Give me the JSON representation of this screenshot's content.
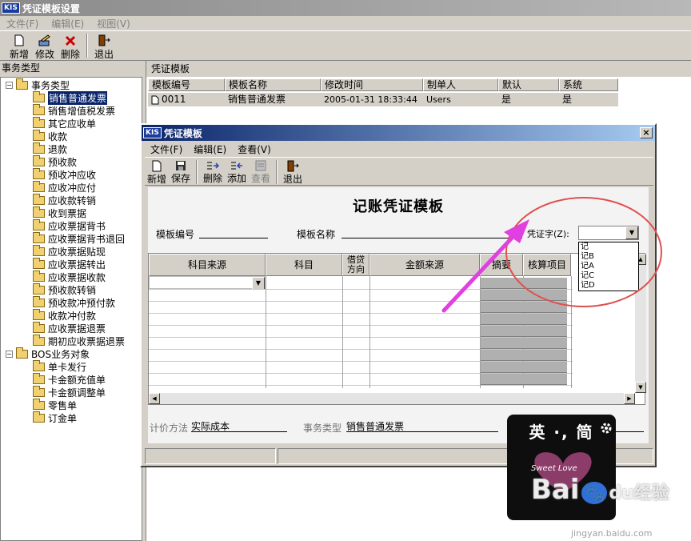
{
  "app": {
    "logo": "KIS",
    "title": "凭证模板设置"
  },
  "menu": [
    "文件(F)",
    "编辑(E)",
    "视图(V)"
  ],
  "toolbar": {
    "new": "新增",
    "edit": "修改",
    "delete": "删除",
    "exit": "退出"
  },
  "left_panel": {
    "header": "事务类型",
    "root1": "事务类型",
    "items1": [
      "销售普通发票",
      "销售增值税发票",
      "其它应收单",
      "收款",
      "退款",
      "预收款",
      "预收冲应收",
      "应收冲应付",
      "应收款转销",
      "收到票据",
      "应收票据背书",
      "应收票据背书退回",
      "应收票据贴现",
      "应收票据转出",
      "应收票据收款",
      "预收款转销",
      "预收款冲预付款",
      "收款冲付款",
      "应收票据退票",
      "期初应收票据退票"
    ],
    "root2": "BOS业务对象",
    "items2": [
      "单卡发行",
      "卡金额充值单",
      "卡金额调整单",
      "零售单",
      "订金单"
    ]
  },
  "right_panel": {
    "header": "凭证模板",
    "columns": [
      "模板编号",
      "模板名称",
      "修改时间",
      "制单人",
      "默认",
      "系统"
    ],
    "rows": [
      [
        "0011",
        "销售普通发票",
        "2005-01-31 18:33:44",
        "Users",
        "是",
        "是"
      ]
    ]
  },
  "dialog": {
    "logo": "KIS",
    "title": "凭证模板",
    "close": "×",
    "menu": [
      "文件(F)",
      "编辑(E)",
      "查看(V)"
    ],
    "toolbar": {
      "new": "新增",
      "save": "保存",
      "delete": "删除",
      "add": "添加",
      "view": "查看",
      "exit": "退出"
    },
    "heading": "记账凭证模板",
    "template_no_label": "模板编号",
    "template_name_label": "模板名称",
    "voucher_word_label": "凭证字(Z):",
    "voucher_options": [
      "记",
      "记B",
      "记A",
      "记C",
      "记D"
    ],
    "grid_headers": [
      "科目来源",
      "科目",
      "借贷\n方向",
      "金额来源",
      "摘要",
      "核算项目"
    ],
    "pricing_label": "计价方法",
    "pricing_value": "实际成本",
    "biz_type_label": "事务类型",
    "biz_type_value": "销售普通发票"
  },
  "watermark": {
    "badge": "英 ·, 简",
    "subtitle": "Sweet Love",
    "brand": "Bai",
    "brand2": "du",
    "site_cn": "经验",
    "site_url": "jingyan.baidu.com"
  },
  "colors": {
    "selection": "#0a246a",
    "annotation": "#e05050",
    "arrow": "#e040e0"
  }
}
